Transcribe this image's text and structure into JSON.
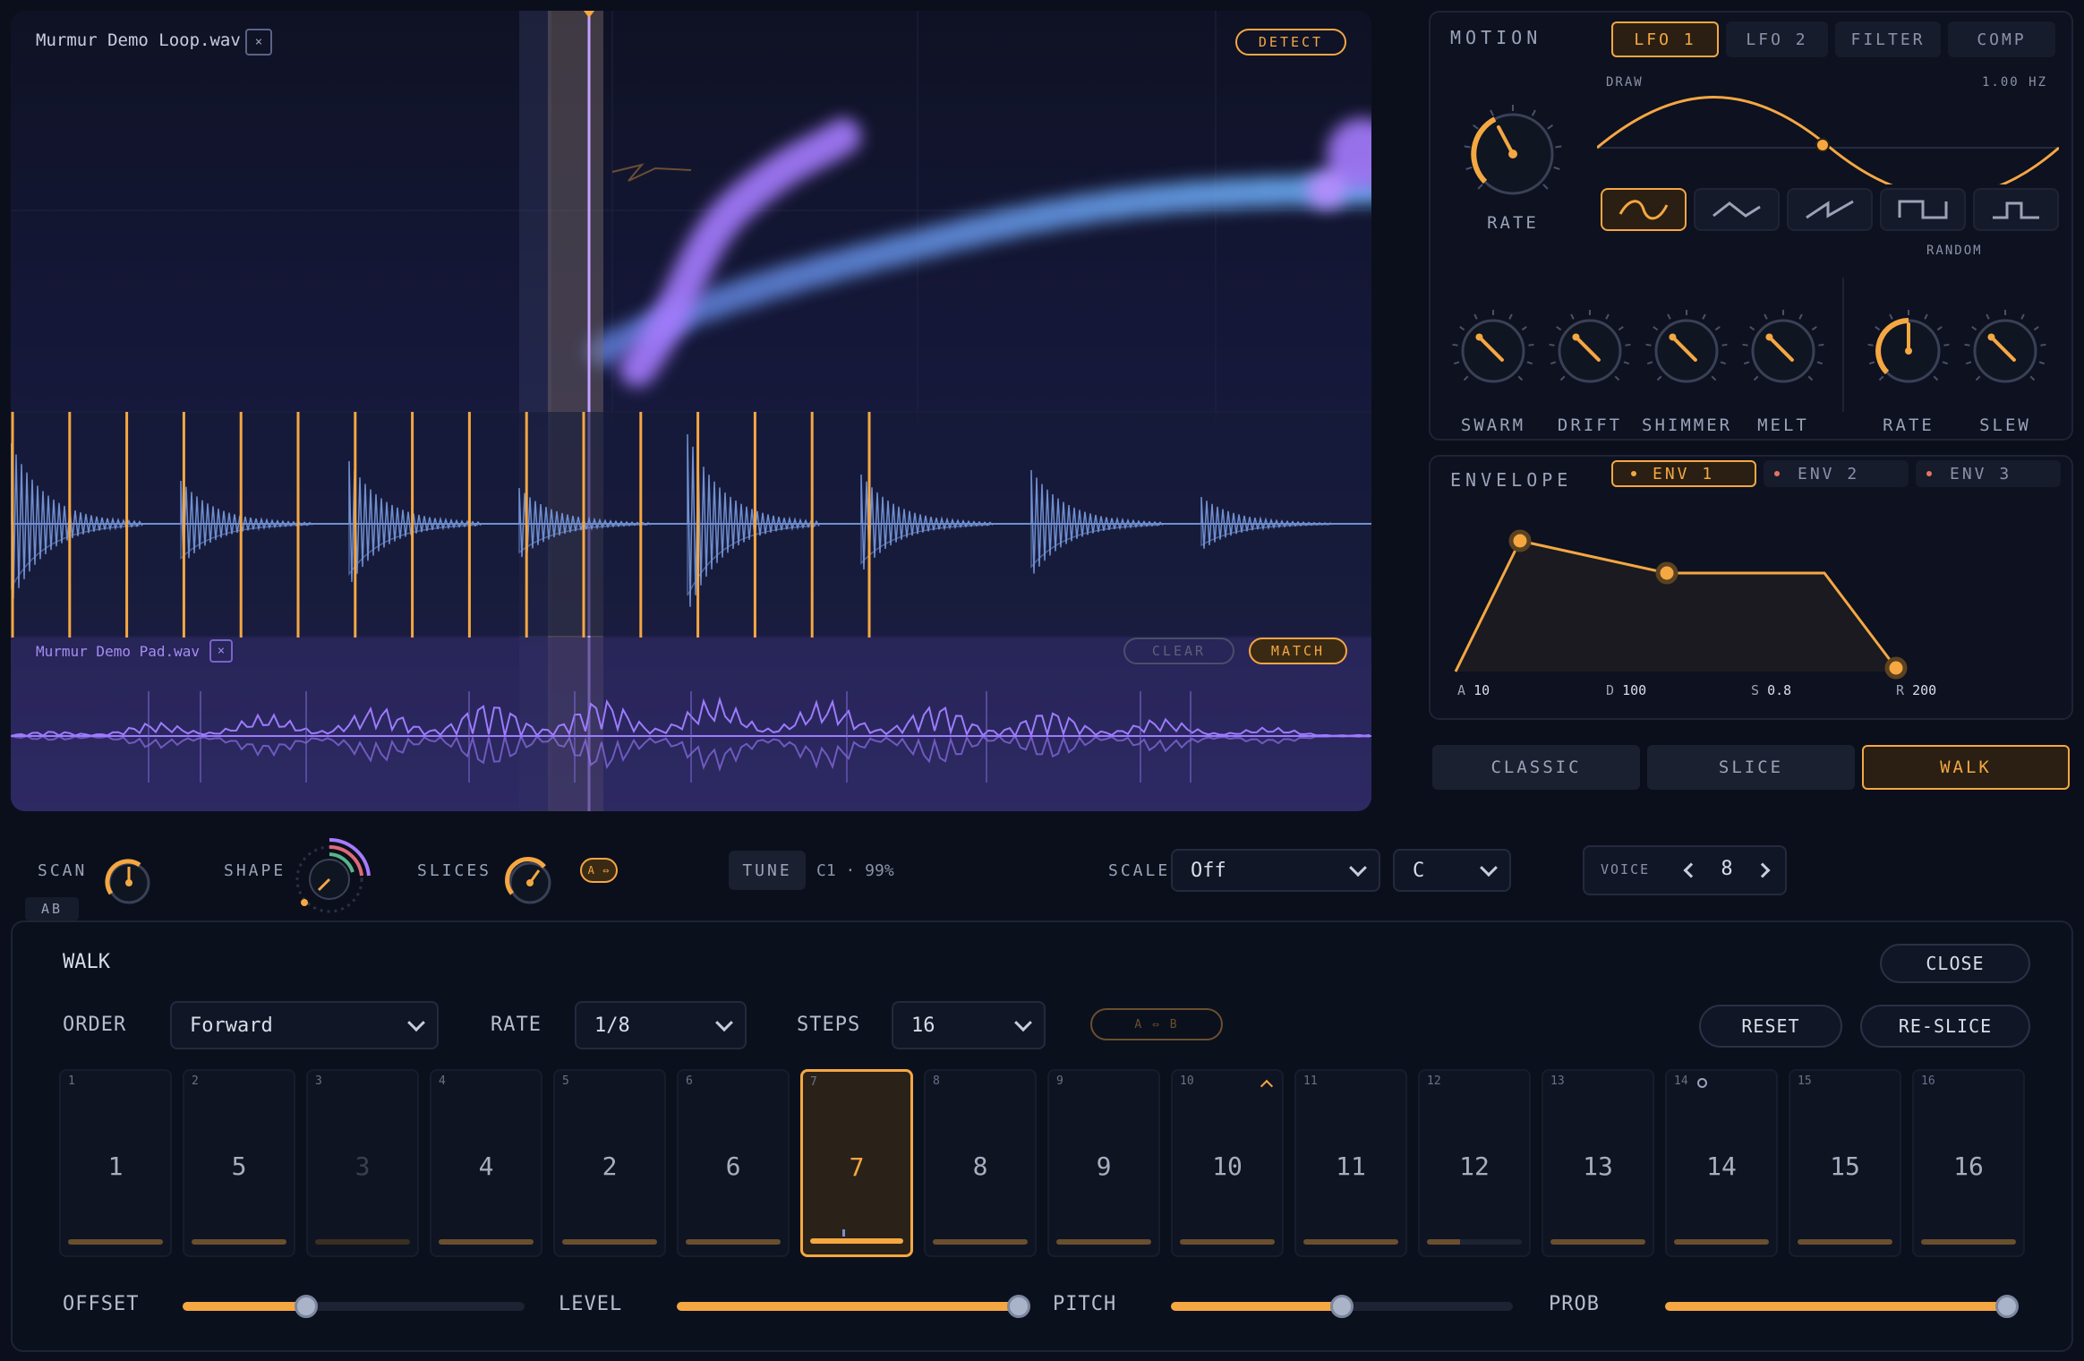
{
  "wave": {
    "file1": "Murmur Demo Loop.wav",
    "file2": "Murmur Demo Pad.wav",
    "close_glyph": "×",
    "detect": "DETECT",
    "clear": "CLEAR",
    "match": "MATCH"
  },
  "motion": {
    "title": "MOTION",
    "tabs": [
      "LFO 1",
      "LFO 2",
      "FILTER",
      "COMP"
    ],
    "active_tab": 0,
    "draw": "DRAW",
    "hz": "1.00 HZ",
    "rate": "RATE",
    "random": "RANDOM",
    "waves": [
      "sine-wave-icon",
      "triangle-wave-icon",
      "saw-wave-icon",
      "square-wave-icon",
      "pulse-wave-icon"
    ],
    "knobs": [
      "SWARM",
      "DRIFT",
      "SHIMMER",
      "MELT"
    ],
    "random_knobs": [
      "RATE",
      "SLEW"
    ]
  },
  "envelope": {
    "title": "ENVELOPE",
    "tabs": [
      "ENV 1",
      "ENV 2",
      "ENV 3"
    ],
    "active_tab": 0,
    "a": "A",
    "a_val": "10",
    "d": "D",
    "d_val": "100",
    "s": "S",
    "s_val": "0.8",
    "r": "R",
    "r_val": "200"
  },
  "modes": [
    "CLASSIC",
    "SLICE",
    "WALK"
  ],
  "active_mode": 2,
  "controls": {
    "scan": "SCAN",
    "shape": "SHAPE",
    "slices": "SLICES",
    "ab_toggle": "A ⇔",
    "ab": "AB",
    "tune": "TUNE",
    "tune_val": "C1 · 99%",
    "scale": "SCALE",
    "scale_val": "Off",
    "key_val": "C",
    "voice": "VOICE",
    "voice_val": "8"
  },
  "walk": {
    "title": "WALK",
    "close": "CLOSE",
    "order": "ORDER",
    "order_val": "Forward",
    "rate": "RATE",
    "rate_val": "1/8",
    "steps": "STEPS",
    "steps_val": "16",
    "ab": "A ⇔ B",
    "reset": "RESET",
    "reslice": "RE-SLICE",
    "cells": [
      {
        "n": "1",
        "v": "1"
      },
      {
        "n": "2",
        "v": "5"
      },
      {
        "n": "3",
        "v": "3"
      },
      {
        "n": "4",
        "v": "4"
      },
      {
        "n": "5",
        "v": "2"
      },
      {
        "n": "6",
        "v": "6"
      },
      {
        "n": "7",
        "v": "7"
      },
      {
        "n": "8",
        "v": "8"
      },
      {
        "n": "9",
        "v": "9"
      },
      {
        "n": "10",
        "v": "10"
      },
      {
        "n": "11",
        "v": "11"
      },
      {
        "n": "12",
        "v": "12"
      },
      {
        "n": "13",
        "v": "13"
      },
      {
        "n": "14",
        "v": "14"
      },
      {
        "n": "15",
        "v": "15"
      },
      {
        "n": "16",
        "v": "16"
      }
    ],
    "active_step": 6,
    "dim_step": 2,
    "sliders": [
      {
        "label": "OFFSET",
        "value": 0.36
      },
      {
        "label": "LEVEL",
        "value": 1.0
      },
      {
        "label": "PITCH",
        "value": 0.5
      },
      {
        "label": "PROB",
        "value": 1.0
      }
    ]
  },
  "colors": {
    "accent": "#f5a742",
    "purple": "#9d7bff",
    "blue": "#6f8fd0"
  }
}
